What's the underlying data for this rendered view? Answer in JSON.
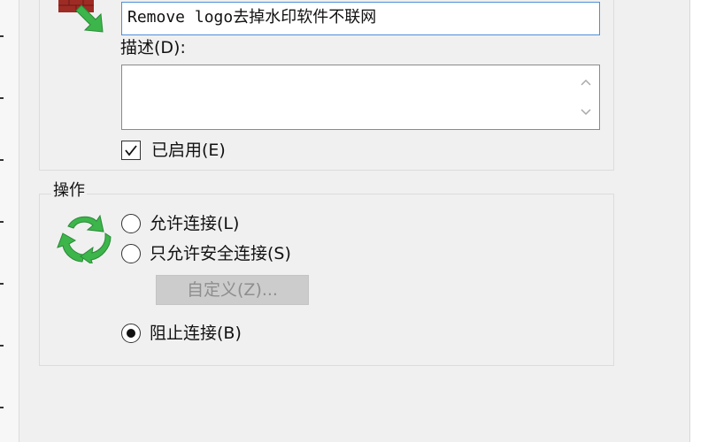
{
  "general": {
    "name_value": "Remove logo去掉水印软件不联网",
    "description_label": "描述(D):",
    "description_value": "",
    "enabled_label": "已启用(E)",
    "enabled": true
  },
  "action": {
    "group_label": "操作",
    "options": [
      {
        "label": "允许连接(L)",
        "selected": false
      },
      {
        "label": "只允许安全连接(S)",
        "selected": false
      },
      {
        "label": "阻止连接(B)",
        "selected": true
      }
    ],
    "custom_button_label": "自定义(Z)...",
    "custom_button_enabled": false
  },
  "icons": {
    "rule_icon": "firewall-brick-arrow-icon",
    "action_icon": "green-sync-arrows-icon"
  },
  "colors": {
    "dialog_bg": "#f0f0f0",
    "input_focus_border": "#4d8fd6",
    "disabled_button_bg": "#cccccc",
    "icon_green": "#3cb54a",
    "icon_brick": "#9e2b24"
  }
}
